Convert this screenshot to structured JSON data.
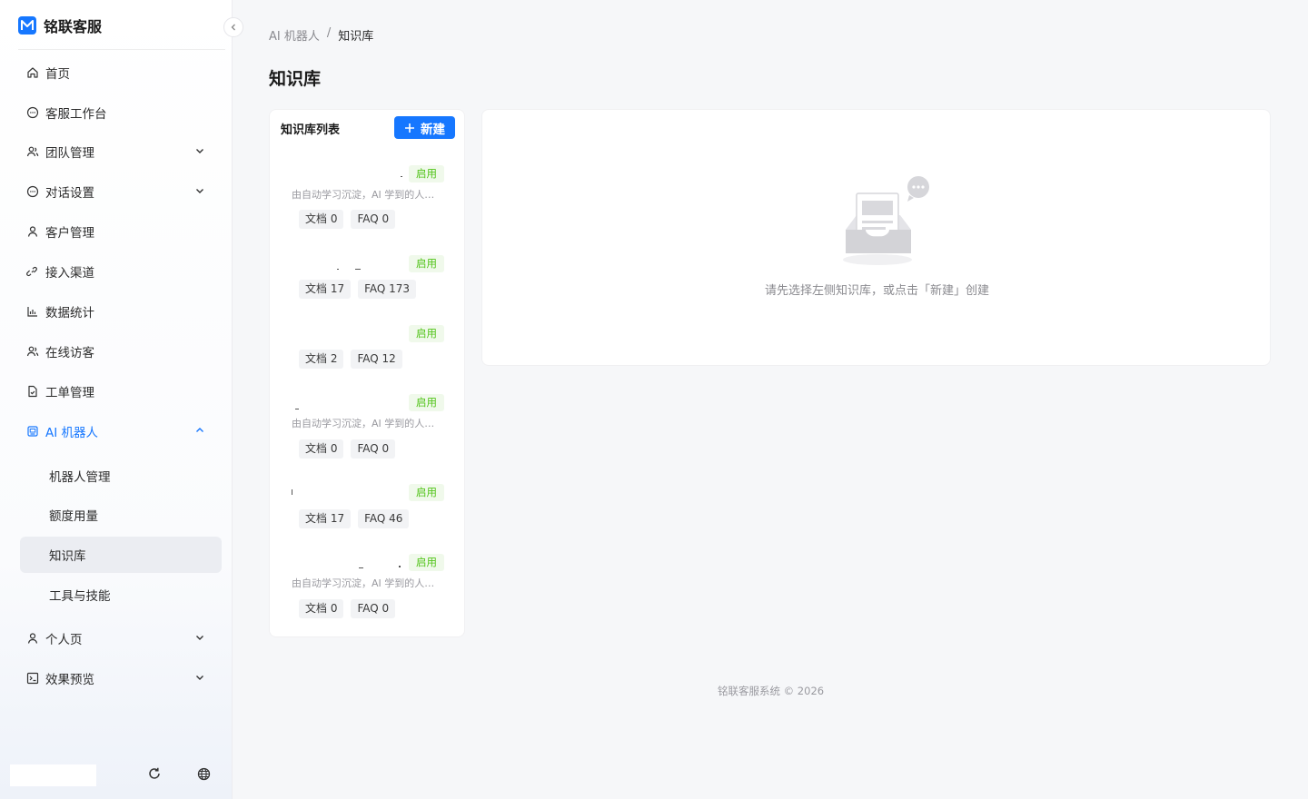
{
  "brand": {
    "name": "铭联客服"
  },
  "sidebar": {
    "items": [
      {
        "label": "首页",
        "icon": "home-icon"
      },
      {
        "label": "客服工作台",
        "icon": "chat-bubble-icon"
      },
      {
        "label": "团队管理",
        "icon": "team-icon"
      },
      {
        "label": "对话设置",
        "icon": "chat-bubble-icon"
      },
      {
        "label": "客户管理",
        "icon": "user-icon"
      },
      {
        "label": "接入渠道",
        "icon": "link-icon"
      },
      {
        "label": "数据统计",
        "icon": "bar-chart-icon"
      },
      {
        "label": "在线访客",
        "icon": "team-icon"
      },
      {
        "label": "工单管理",
        "icon": "document-icon"
      },
      {
        "label": "AI 机器人",
        "icon": "robot-icon"
      },
      {
        "label": "个人页",
        "icon": "user-icon"
      },
      {
        "label": "效果预览",
        "icon": "preview-icon"
      }
    ],
    "ai_sub_items": [
      {
        "label": "机器人管理"
      },
      {
        "label": "额度用量"
      },
      {
        "label": "知识库"
      },
      {
        "label": "工具与技能"
      }
    ]
  },
  "breadcrumb": {
    "parent": "AI 机器人",
    "separator": "/",
    "current": "知识库"
  },
  "page": {
    "title": "知识库"
  },
  "kb_list": {
    "title": "知识库列表",
    "new_label": "新建",
    "cards": [
      {
        "status": "启用",
        "description": "由自动学习沉淀，AI 学到的人…",
        "doc": "文档 0",
        "faq": "FAQ 0"
      },
      {
        "status": "启用",
        "description": "",
        "doc": "文档 17",
        "faq": "FAQ 173"
      },
      {
        "status": "启用",
        "description": "",
        "doc": "文档 2",
        "faq": "FAQ 12"
      },
      {
        "status": "启用",
        "description": "由自动学习沉淀，AI 学到的人…",
        "doc": "文档 0",
        "faq": "FAQ 0"
      },
      {
        "status": "启用",
        "description": "",
        "doc": "文档 17",
        "faq": "FAQ 46"
      },
      {
        "status": "启用",
        "description": "由自动学习沉淀，AI 学到的人…",
        "doc": "文档 0",
        "faq": "FAQ 0"
      }
    ]
  },
  "empty_state": {
    "text": "请先选择左侧知识库，或点击「新建」创建"
  },
  "footer": {
    "text": "铭联客服系统 © 2026"
  },
  "colors": {
    "accent": "#1677ff",
    "status_green": "#52c41a"
  }
}
